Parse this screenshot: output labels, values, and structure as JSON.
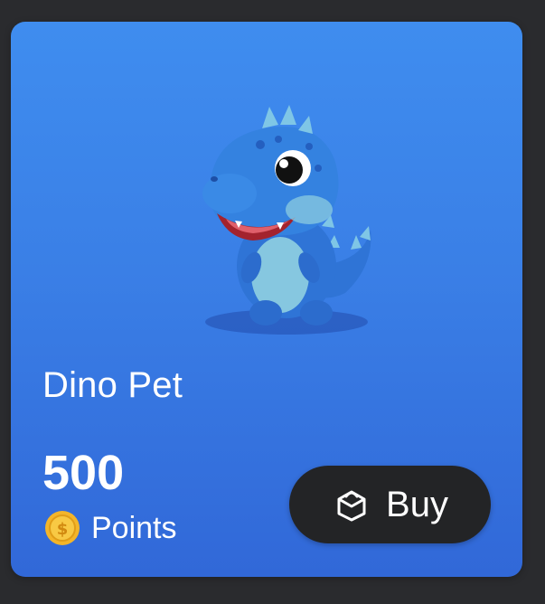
{
  "card": {
    "title": "Dino Pet",
    "image": "blue-dinosaur-pet-illustration",
    "background_colors": [
      "#3f8def",
      "#3168d8"
    ]
  },
  "price": {
    "amount": "500",
    "currency_icon": "gold-coin-icon",
    "currency_label": "Points"
  },
  "buy_button": {
    "icon": "shopping-bag-icon",
    "label": "Buy",
    "background_color": "#232426"
  }
}
